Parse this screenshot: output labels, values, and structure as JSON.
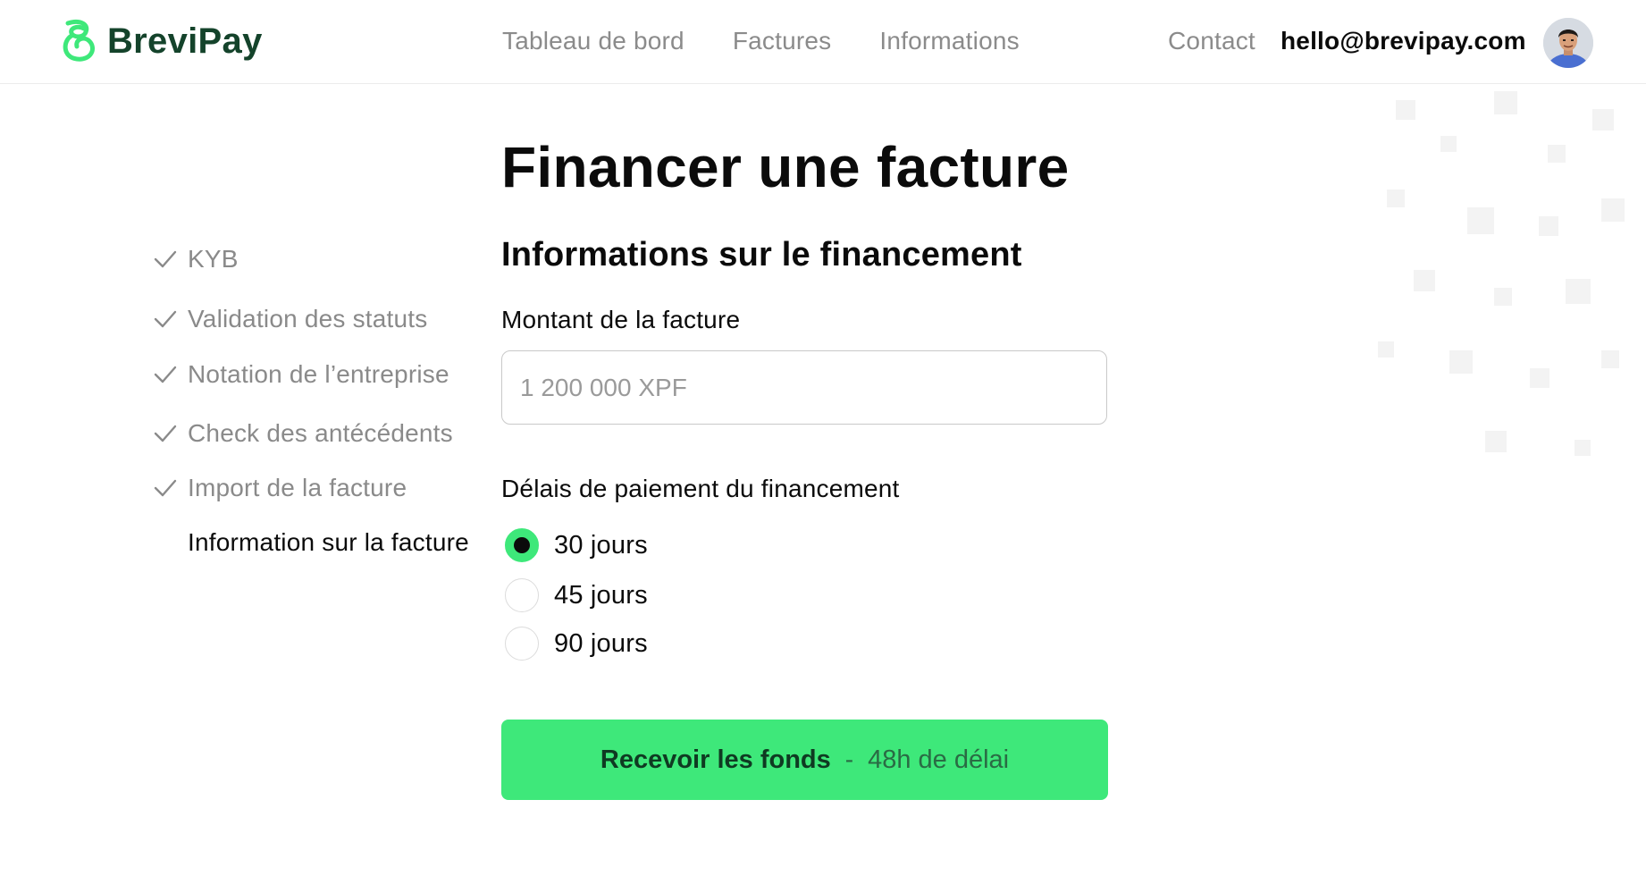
{
  "brand": {
    "name": "BreviPay",
    "accent": "#3ee87a",
    "dark_green": "#14432b"
  },
  "header": {
    "nav": [
      {
        "label": "Tableau de bord"
      },
      {
        "label": "Factures"
      },
      {
        "label": "Informations"
      }
    ],
    "contact_label": "Contact",
    "email": "hello@brevipay.com",
    "avatar_icon": "user-avatar"
  },
  "page_title": "Financer une facture",
  "steps": [
    {
      "label": "KYB",
      "done": true
    },
    {
      "label": "Validation des statuts",
      "done": true
    },
    {
      "label": "Notation de l’entreprise",
      "done": true
    },
    {
      "label": "Check des antécédents",
      "done": true
    },
    {
      "label": "Import de la facture",
      "done": true
    },
    {
      "label": "Information sur la facture",
      "done": false,
      "current": true
    }
  ],
  "form": {
    "section_title": "Informations sur le financement",
    "amount_label": "Montant de la facture",
    "amount_placeholder": "1 200 000 XPF",
    "amount_value": "",
    "terms_label": "Délais de paiement du financement",
    "terms_options": [
      {
        "label": "30 jours",
        "selected": true
      },
      {
        "label": "45 jours",
        "selected": false
      },
      {
        "label": "90 jours",
        "selected": false
      }
    ],
    "submit_label": "Recevoir les fonds",
    "submit_separator": "-",
    "submit_sublabel": "48h de délai"
  }
}
